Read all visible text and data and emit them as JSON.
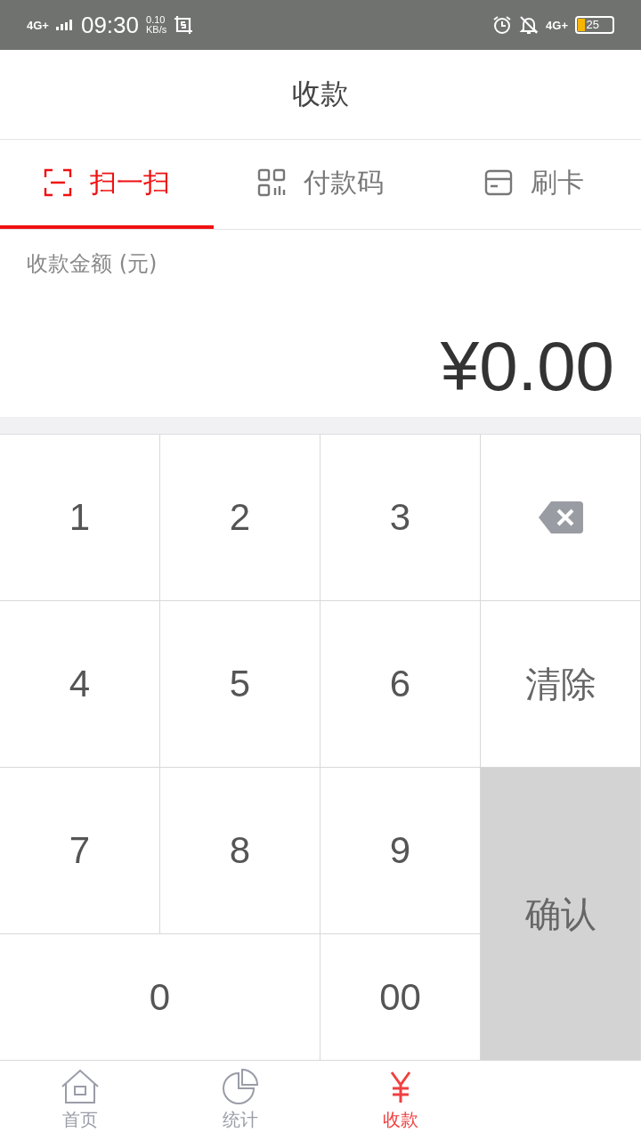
{
  "status_bar": {
    "network": "4G+",
    "time": "09:30",
    "speed_value": "0.10",
    "speed_unit": "KB/s",
    "network_right": "4G+",
    "battery": "25"
  },
  "header": {
    "title": "收款"
  },
  "tabs": [
    {
      "label": "扫一扫",
      "kind": "scan",
      "selected": true
    },
    {
      "label": "付款码",
      "kind": "qr",
      "selected": false
    },
    {
      "label": "刷卡",
      "kind": "card",
      "selected": false
    }
  ],
  "amount": {
    "label": "收款金额 (元)",
    "value": "¥0.00"
  },
  "keypad": [
    {
      "kind": "digit",
      "label": "1"
    },
    {
      "kind": "digit",
      "label": "2"
    },
    {
      "kind": "digit",
      "label": "3"
    },
    {
      "kind": "backspace"
    },
    {
      "kind": "digit",
      "label": "4"
    },
    {
      "kind": "digit",
      "label": "5"
    },
    {
      "kind": "digit",
      "label": "6"
    },
    {
      "kind": "clear",
      "label": "清除"
    },
    {
      "kind": "digit",
      "label": "7"
    },
    {
      "kind": "digit",
      "label": "8"
    },
    {
      "kind": "digit",
      "label": "9"
    },
    {
      "kind": "confirm",
      "label": "确认"
    },
    {
      "kind": "wide",
      "label": "0"
    },
    {
      "kind": "digit",
      "label": "00"
    }
  ],
  "bottom_nav": [
    {
      "label": "首页",
      "kind": "home",
      "selected": false
    },
    {
      "label": "统计",
      "kind": "chart",
      "selected": false
    },
    {
      "label": "收款",
      "kind": "yen",
      "selected": true
    }
  ]
}
